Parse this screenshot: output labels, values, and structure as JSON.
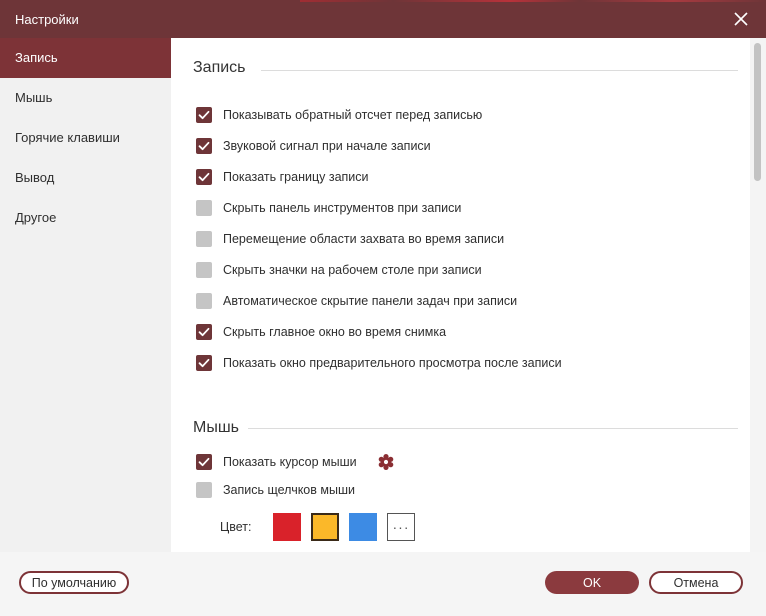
{
  "window": {
    "title": "Настройки"
  },
  "sidebar": {
    "items": [
      {
        "label": "Запись",
        "active": true
      },
      {
        "label": "Мышь",
        "active": false
      },
      {
        "label": "Горячие клавиши",
        "active": false
      },
      {
        "label": "Вывод",
        "active": false
      },
      {
        "label": "Другое",
        "active": false
      }
    ]
  },
  "recording": {
    "title": "Запись",
    "options": [
      {
        "label": "Показывать обратный отсчет перед записью",
        "checked": true
      },
      {
        "label": "Звуковой сигнал при начале записи",
        "checked": true
      },
      {
        "label": "Показать границу записи",
        "checked": true
      },
      {
        "label": "Скрыть панель инструментов при записи",
        "checked": false
      },
      {
        "label": "Перемещение области захвата во время записи",
        "checked": false
      },
      {
        "label": "Скрыть значки на рабочем столе при записи",
        "checked": false
      },
      {
        "label": "Автоматическое скрытие панели задач при записи",
        "checked": false
      },
      {
        "label": "Скрыть главное окно во время снимка",
        "checked": true
      },
      {
        "label": "Показать окно предварительного просмотра после записи",
        "checked": true
      }
    ]
  },
  "mouse": {
    "title": "Мышь",
    "options": [
      {
        "label": "Показать курсор мыши",
        "checked": true
      },
      {
        "label": "Запись щелчков мыши",
        "checked": false
      }
    ],
    "color_label": "Цвет:",
    "swatches": [
      {
        "color": "#d9222a",
        "selected": false
      },
      {
        "color": "#fbb829",
        "selected": true
      },
      {
        "color": "#3d8be4",
        "selected": false
      }
    ],
    "more_label": "···"
  },
  "footer": {
    "default_label": "По умолчанию",
    "ok_label": "OK",
    "cancel_label": "Отмена"
  },
  "colors": {
    "accent": "#6e3538",
    "sidebar_active": "#7d3337",
    "ok_button": "#8b3a3e"
  }
}
